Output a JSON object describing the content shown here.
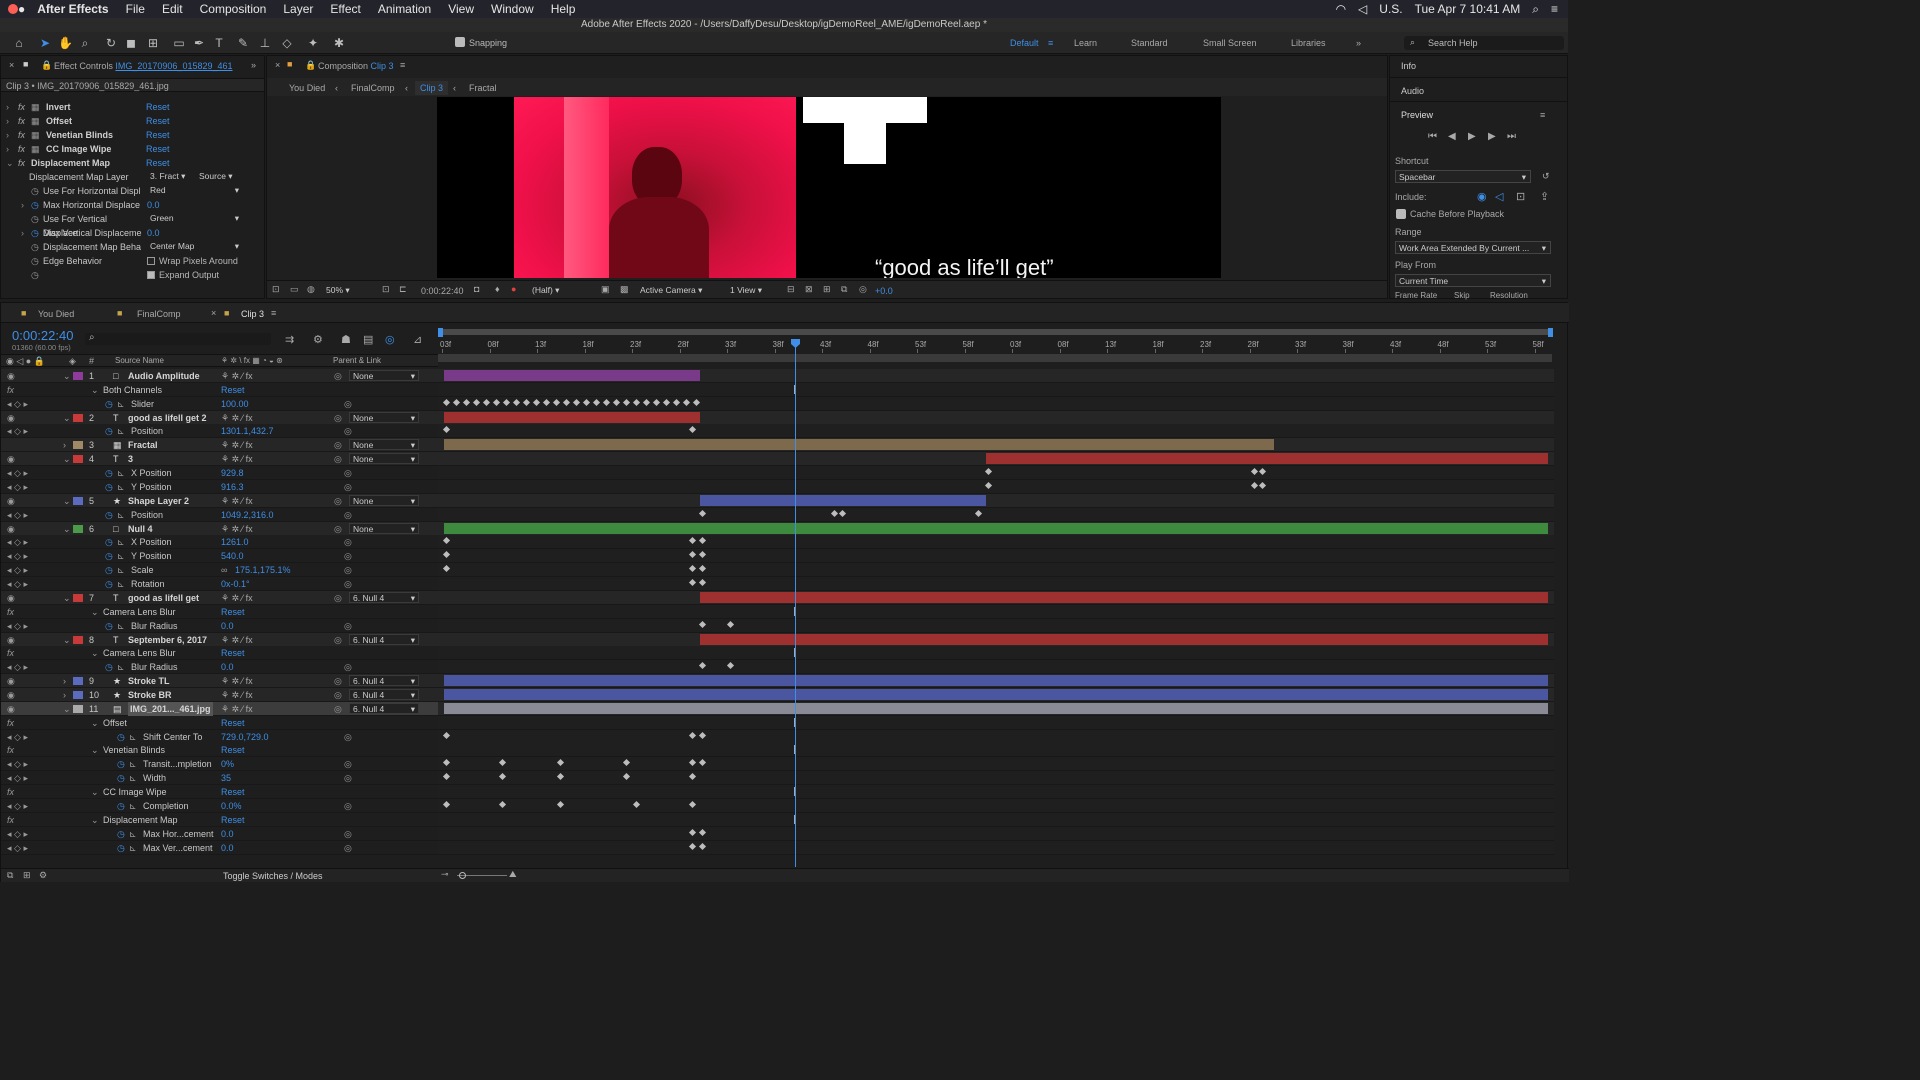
{
  "menubar": {
    "app": "After Effects",
    "items": [
      "File",
      "Edit",
      "Composition",
      "Layer",
      "Effect",
      "Animation",
      "View",
      "Window",
      "Help"
    ],
    "right": {
      "lang": "U.S.",
      "datetime": "Tue Apr 7  10:41 AM"
    }
  },
  "title": "Adobe After Effects 2020 - /Users/DaffyDesu/Desktop/igDemoReel_AME/igDemoReel.aep *",
  "toolbar": {
    "snapping": "Snapping",
    "workspaces": [
      "Default",
      "Learn",
      "Standard",
      "Small Screen",
      "Libraries"
    ],
    "search_placeholder": "Search Help"
  },
  "effect_controls": {
    "tab_prefix": "Effect Controls",
    "tab_layer": "IMG_20170906_015829_461",
    "header": "Clip 3 • IMG_20170906_015829_461.jpg",
    "effects": [
      {
        "name": "Invert",
        "reset": "Reset"
      },
      {
        "name": "Offset",
        "reset": "Reset"
      },
      {
        "name": "Venetian Blinds",
        "reset": "Reset"
      },
      {
        "name": "CC Image Wipe",
        "reset": "Reset"
      },
      {
        "name": "Displacement Map",
        "reset": "Reset"
      }
    ],
    "props": [
      {
        "label": "Displacement Map Layer",
        "value": "3. Fract",
        "extra": "Source"
      },
      {
        "label": "Use For Horizontal Displ",
        "value": "Red"
      },
      {
        "label": "Max Horizontal Displace",
        "value": "0.0"
      },
      {
        "label": "Use For Vertical Displace",
        "value": "Green"
      },
      {
        "label": "Max Vertical Displaceme",
        "value": "0.0"
      },
      {
        "label": "Displacement Map Beha",
        "value": "Center Map"
      },
      {
        "label": "Edge Behavior",
        "value": "Wrap Pixels Around"
      },
      {
        "label": "",
        "value": "Expand Output"
      }
    ]
  },
  "composition": {
    "tab_prefix": "Composition",
    "tab_name": "Clip 3",
    "breadcrumbs": [
      "You Died",
      "FinalComp",
      "Clip 3",
      "Fractal"
    ],
    "caption": "“good as life’ll get”",
    "footer": {
      "zoom": "50%",
      "time": "0:00:22:40",
      "resolution": "(Half)",
      "camera": "Active Camera",
      "views": "1 View",
      "exposure": "+0.0"
    }
  },
  "right_panel": {
    "info": "Info",
    "audio": "Audio",
    "preview": "Preview",
    "shortcut_label": "Shortcut",
    "shortcut_value": "Spacebar",
    "include_label": "Include:",
    "cache_label": "Cache Before Playback",
    "range_label": "Range",
    "range_value": "Work Area Extended By Current ...",
    "playfrom_label": "Play From",
    "playfrom_value": "Current Time",
    "bottom_labels": [
      "Frame Rate",
      "Skip",
      "Resolution"
    ]
  },
  "timeline": {
    "tabs": [
      "You Died",
      "FinalComp",
      "Clip 3"
    ],
    "timecode": "0:00:22:40",
    "fps": "01360 (60.00 fps)",
    "col_source": "Source Name",
    "col_parent": "Parent & Link",
    "toggle": "Toggle Switches / Modes",
    "ruler": [
      "03f",
      "08f",
      "13f",
      "18f",
      "23f",
      "28f",
      "33f",
      "38f",
      "43f",
      "48f",
      "53f",
      "58f",
      "03f",
      "08f",
      "13f",
      "18f",
      "23f",
      "28f",
      "33f",
      "38f",
      "43f",
      "48f",
      "53f",
      "58f"
    ],
    "rows": [
      {
        "t": "layer",
        "num": "1",
        "name": "Audio Amplitude",
        "color": "#8e3b9c",
        "icon": "□",
        "parent": "None",
        "vis": true
      },
      {
        "t": "fxgroup",
        "name": "Both Channels",
        "value": "Reset"
      },
      {
        "t": "prop",
        "name": "Slider",
        "value": "100.00"
      },
      {
        "t": "layer",
        "num": "2",
        "name": "good as lifell get 2",
        "color": "#c83a3a",
        "icon": "T",
        "parent": "None",
        "vis": true
      },
      {
        "t": "prop",
        "name": "Position",
        "value": "1301.1,432.7"
      },
      {
        "t": "layer",
        "num": "3",
        "name": "Fractal",
        "color": "#a08a66",
        "icon": "▦",
        "parent": "None",
        "vis": false
      },
      {
        "t": "layer",
        "num": "4",
        "name": "3",
        "color": "#c83a3a",
        "icon": "T",
        "parent": "None",
        "vis": true
      },
      {
        "t": "prop",
        "name": "X Position",
        "value": "929.8"
      },
      {
        "t": "prop",
        "name": "Y Position",
        "value": "916.3"
      },
      {
        "t": "layer",
        "num": "5",
        "name": "Shape Layer 2",
        "color": "#5b6bbd",
        "icon": "★",
        "parent": "None",
        "vis": true
      },
      {
        "t": "prop",
        "name": "Position",
        "value": "1049.2,316.0"
      },
      {
        "t": "layer",
        "num": "6",
        "name": "Null 4",
        "color": "#4a9a4a",
        "icon": "□",
        "parent": "None",
        "vis": true
      },
      {
        "t": "prop",
        "name": "X Position",
        "value": "1261.0"
      },
      {
        "t": "prop",
        "name": "Y Position",
        "value": "540.0"
      },
      {
        "t": "prop",
        "name": "Scale",
        "value": "175.1,175.1%"
      },
      {
        "t": "prop",
        "name": "Rotation",
        "value": "0x-0.1°"
      },
      {
        "t": "layer",
        "num": "7",
        "name": "good as lifell get",
        "color": "#c83a3a",
        "icon": "T",
        "parent": "6. Null 4",
        "vis": true
      },
      {
        "t": "fxgroup",
        "name": "Camera Lens Blur",
        "value": "Reset"
      },
      {
        "t": "prop",
        "name": "Blur Radius",
        "value": "0.0"
      },
      {
        "t": "layer",
        "num": "8",
        "name": "September 6, 2017",
        "color": "#c83a3a",
        "icon": "T",
        "parent": "6. Null 4",
        "vis": true
      },
      {
        "t": "fxgroup",
        "name": "Camera Lens Blur",
        "value": "Reset"
      },
      {
        "t": "prop",
        "name": "Blur Radius",
        "value": "0.0"
      },
      {
        "t": "layer",
        "num": "9",
        "name": "Stroke TL",
        "color": "#5b6bbd",
        "icon": "★",
        "parent": "6. Null 4",
        "vis": true
      },
      {
        "t": "layer",
        "num": "10",
        "name": "Stroke BR",
        "color": "#5b6bbd",
        "icon": "★",
        "parent": "6. Null 4",
        "vis": true
      },
      {
        "t": "layer",
        "num": "11",
        "name": "IMG_201..._461.jpg",
        "color": "#aaaaaa",
        "icon": "▤",
        "parent": "6. Null 4",
        "vis": true,
        "selected": true
      },
      {
        "t": "fxgroup",
        "name": "Offset",
        "value": "Reset"
      },
      {
        "t": "prop",
        "name": "Shift Center To",
        "value": "729.0,729.0"
      },
      {
        "t": "fxgroup",
        "name": "Venetian Blinds",
        "value": "Reset"
      },
      {
        "t": "prop",
        "name": "Transit...mpletion",
        "value": "0%"
      },
      {
        "t": "prop",
        "name": "Width",
        "value": "35"
      },
      {
        "t": "fxgroup",
        "name": "CC Image Wipe",
        "value": "Reset"
      },
      {
        "t": "prop",
        "name": "Completion",
        "value": "0.0%"
      },
      {
        "t": "fxgroup",
        "name": "Displacement Map",
        "value": "Reset"
      },
      {
        "t": "prop",
        "name": "Max Hor...cement",
        "value": "0.0"
      },
      {
        "t": "prop",
        "name": "Max Ver...cement",
        "value": "0.0"
      }
    ]
  }
}
